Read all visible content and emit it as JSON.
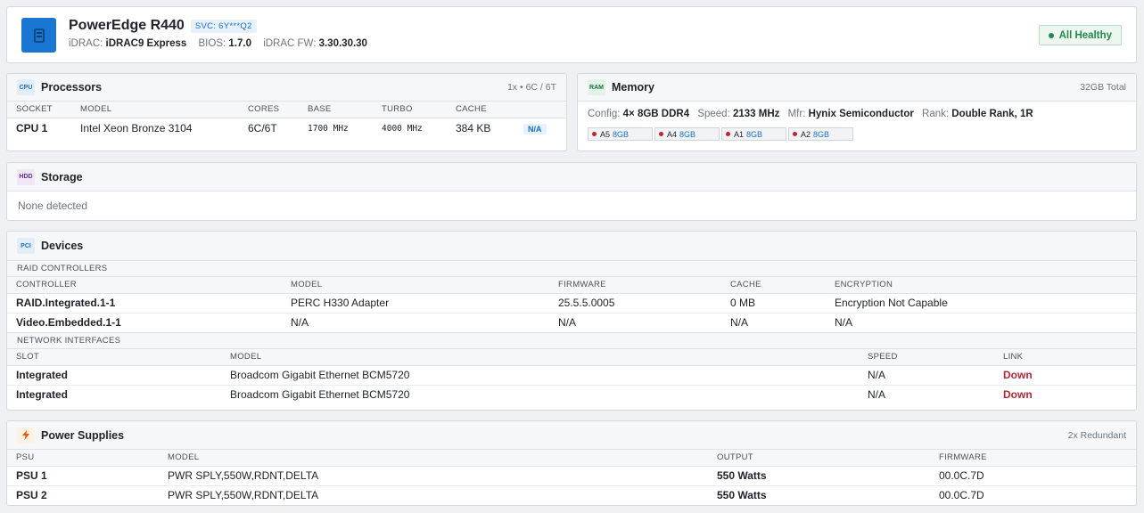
{
  "header": {
    "title": "PowerEdge R440",
    "svc": "SVC: 6Y***Q2",
    "idrac_label": "iDRAC:",
    "idrac_value": "iDRAC9 Express",
    "bios_label": "BIOS:",
    "bios_value": "1.7.0",
    "fw_label": "iDRAC FW:",
    "fw_value": "3.30.30.30",
    "status": "All Healthy"
  },
  "processors": {
    "icon_label": "CPU",
    "title": "Processors",
    "meta": "1x • 6C / 6T",
    "columns": [
      "SOCKET",
      "MODEL",
      "CORES",
      "BASE",
      "TURBO",
      "CACHE",
      ""
    ],
    "rows": [
      {
        "socket": "CPU 1",
        "model": "Intel Xeon Bronze 3104",
        "cores": "6C/6T",
        "base": "1700 MHz",
        "turbo": "4000 MHz",
        "cache": "384 KB",
        "badge": "N/A"
      }
    ]
  },
  "memory": {
    "icon_label": "RAM",
    "title": "Memory",
    "meta": "32GB Total",
    "config_label": "Config:",
    "config_value": "4× 8GB DDR4",
    "speed_label": "Speed:",
    "speed_value": "2133 MHz",
    "mfr_label": "Mfr:",
    "mfr_value": "Hynix Semiconductor",
    "rank_label": "Rank:",
    "rank_value": "Double Rank, 1R",
    "dimms": [
      {
        "slot": "A5",
        "size": "8GB"
      },
      {
        "slot": "A4",
        "size": "8GB"
      },
      {
        "slot": "A1",
        "size": "8GB"
      },
      {
        "slot": "A2",
        "size": "8GB"
      }
    ]
  },
  "storage": {
    "icon_label": "HDD",
    "title": "Storage",
    "empty_text": "None detected"
  },
  "devices": {
    "icon_label": "PCI",
    "title": "Devices",
    "raid_heading": "RAID CONTROLLERS",
    "raid_columns": [
      "CONTROLLER",
      "MODEL",
      "FIRMWARE",
      "CACHE",
      "ENCRYPTION"
    ],
    "raid_rows": [
      {
        "controller": "RAID.Integrated.1-1",
        "model": "PERC H330 Adapter",
        "firmware": "25.5.5.0005",
        "cache": "0 MB",
        "encryption": "Encryption Not Capable"
      },
      {
        "controller": "Video.Embedded.1-1",
        "model": "N/A",
        "firmware": "N/A",
        "cache": "N/A",
        "encryption": "N/A"
      }
    ],
    "net_heading": "NETWORK INTERFACES",
    "net_columns": [
      "SLOT",
      "MODEL",
      "SPEED",
      "LINK"
    ],
    "net_rows": [
      {
        "slot": "Integrated",
        "model": "Broadcom Gigabit Ethernet BCM5720",
        "speed": "N/A",
        "link": "Down"
      },
      {
        "slot": "Integrated",
        "model": "Broadcom Gigabit Ethernet BCM5720",
        "speed": "N/A",
        "link": "Down"
      }
    ]
  },
  "power": {
    "icon_name": "lightning-icon",
    "title": "Power Supplies",
    "meta": "2x Redundant",
    "columns": [
      "PSU",
      "MODEL",
      "OUTPUT",
      "FIRMWARE"
    ],
    "rows": [
      {
        "psu": "PSU 1",
        "model": "PWR SPLY,550W,RDNT,DELTA",
        "output": "550 Watts",
        "firmware": "00.0C.7D"
      },
      {
        "psu": "PSU 2",
        "model": "PWR SPLY,550W,RDNT,DELTA",
        "output": "550 Watts",
        "firmware": "00.0C.7D"
      }
    ]
  },
  "colors": {
    "accent": "#1976d2",
    "healthy": "#1e8a4c",
    "down": "#b02a37",
    "background": "#eef0f2"
  }
}
